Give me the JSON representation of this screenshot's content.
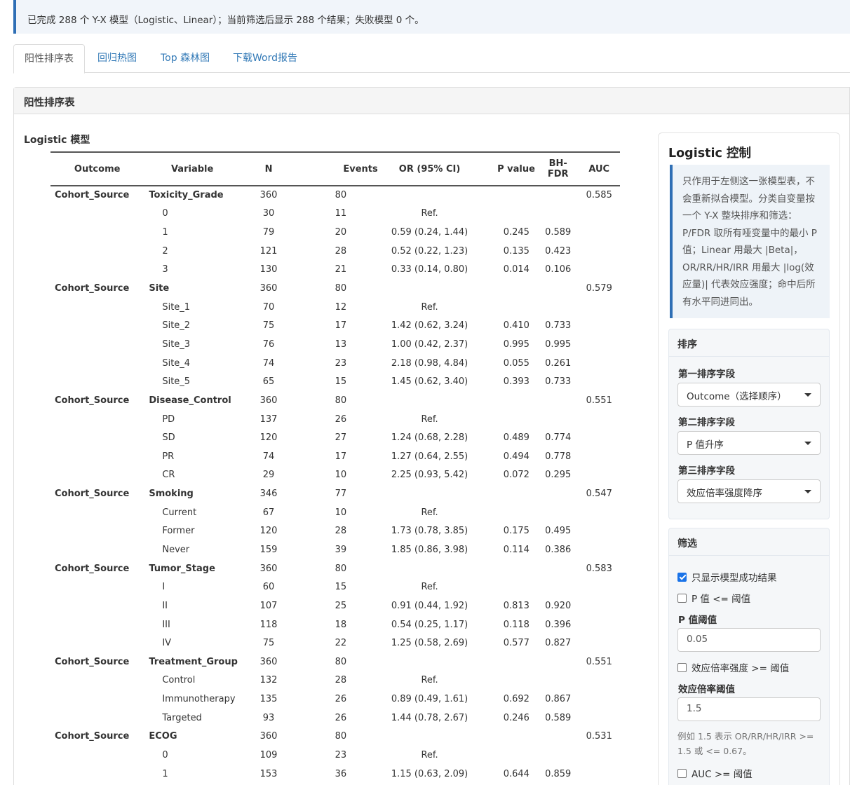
{
  "notice": "已完成 288 个 Y-X 模型（Logistic、Linear）；当前筛选后显示 288 个结果；失败模型 0 个。",
  "tabs": [
    "阳性排序表",
    "回归热图",
    "Top 森林图",
    "下载Word报告"
  ],
  "panel_title": "阳性排序表",
  "section_title": "Logistic 模型",
  "table": {
    "headers": {
      "outcome": "Outcome",
      "variable": "Variable",
      "n": "N",
      "events": "Events",
      "or": "OR (95% CI)",
      "p": "P value",
      "fdr": "BH-FDR",
      "auc": "AUC"
    },
    "rows": [
      {
        "t": "g",
        "outcome": "Cohort_Source",
        "variable": "Toxicity_Grade",
        "n": "360",
        "events": "80",
        "or": "",
        "p": "",
        "fdr": "",
        "auc": "0.585"
      },
      {
        "t": "l",
        "outcome": "",
        "variable": "0",
        "n": "30",
        "events": "11",
        "or": "Ref.",
        "p": "",
        "fdr": "",
        "auc": ""
      },
      {
        "t": "l",
        "outcome": "",
        "variable": "1",
        "n": "79",
        "events": "20",
        "or": "0.59 (0.24, 1.44)",
        "p": "0.245",
        "fdr": "0.589",
        "auc": ""
      },
      {
        "t": "l",
        "outcome": "",
        "variable": "2",
        "n": "121",
        "events": "28",
        "or": "0.52 (0.22, 1.23)",
        "p": "0.135",
        "fdr": "0.423",
        "auc": ""
      },
      {
        "t": "l",
        "outcome": "",
        "variable": "3",
        "n": "130",
        "events": "21",
        "or": "0.33 (0.14, 0.80)",
        "p": "0.014",
        "fdr": "0.106",
        "auc": ""
      },
      {
        "t": "g",
        "outcome": "Cohort_Source",
        "variable": "Site",
        "n": "360",
        "events": "80",
        "or": "",
        "p": "",
        "fdr": "",
        "auc": "0.579"
      },
      {
        "t": "l",
        "outcome": "",
        "variable": "Site_1",
        "n": "70",
        "events": "12",
        "or": "Ref.",
        "p": "",
        "fdr": "",
        "auc": ""
      },
      {
        "t": "l",
        "outcome": "",
        "variable": "Site_2",
        "n": "75",
        "events": "17",
        "or": "1.42 (0.62, 3.24)",
        "p": "0.410",
        "fdr": "0.733",
        "auc": ""
      },
      {
        "t": "l",
        "outcome": "",
        "variable": "Site_3",
        "n": "76",
        "events": "13",
        "or": "1.00 (0.42, 2.37)",
        "p": "0.995",
        "fdr": "0.995",
        "auc": ""
      },
      {
        "t": "l",
        "outcome": "",
        "variable": "Site_4",
        "n": "74",
        "events": "23",
        "or": "2.18 (0.98, 4.84)",
        "p": "0.055",
        "fdr": "0.261",
        "auc": ""
      },
      {
        "t": "l",
        "outcome": "",
        "variable": "Site_5",
        "n": "65",
        "events": "15",
        "or": "1.45 (0.62, 3.40)",
        "p": "0.393",
        "fdr": "0.733",
        "auc": ""
      },
      {
        "t": "g",
        "outcome": "Cohort_Source",
        "variable": "Disease_Control",
        "n": "360",
        "events": "80",
        "or": "",
        "p": "",
        "fdr": "",
        "auc": "0.551"
      },
      {
        "t": "l",
        "outcome": "",
        "variable": "PD",
        "n": "137",
        "events": "26",
        "or": "Ref.",
        "p": "",
        "fdr": "",
        "auc": ""
      },
      {
        "t": "l",
        "outcome": "",
        "variable": "SD",
        "n": "120",
        "events": "27",
        "or": "1.24 (0.68, 2.28)",
        "p": "0.489",
        "fdr": "0.774",
        "auc": ""
      },
      {
        "t": "l",
        "outcome": "",
        "variable": "PR",
        "n": "74",
        "events": "17",
        "or": "1.27 (0.64, 2.55)",
        "p": "0.494",
        "fdr": "0.778",
        "auc": ""
      },
      {
        "t": "l",
        "outcome": "",
        "variable": "CR",
        "n": "29",
        "events": "10",
        "or": "2.25 (0.93, 5.42)",
        "p": "0.072",
        "fdr": "0.295",
        "auc": ""
      },
      {
        "t": "g",
        "outcome": "Cohort_Source",
        "variable": "Smoking",
        "n": "346",
        "events": "77",
        "or": "",
        "p": "",
        "fdr": "",
        "auc": "0.547"
      },
      {
        "t": "l",
        "outcome": "",
        "variable": "Current",
        "n": "67",
        "events": "10",
        "or": "Ref.",
        "p": "",
        "fdr": "",
        "auc": ""
      },
      {
        "t": "l",
        "outcome": "",
        "variable": "Former",
        "n": "120",
        "events": "28",
        "or": "1.73 (0.78, 3.85)",
        "p": "0.175",
        "fdr": "0.495",
        "auc": ""
      },
      {
        "t": "l",
        "outcome": "",
        "variable": "Never",
        "n": "159",
        "events": "39",
        "or": "1.85 (0.86, 3.98)",
        "p": "0.114",
        "fdr": "0.386",
        "auc": ""
      },
      {
        "t": "g",
        "outcome": "Cohort_Source",
        "variable": "Tumor_Stage",
        "n": "360",
        "events": "80",
        "or": "",
        "p": "",
        "fdr": "",
        "auc": "0.583"
      },
      {
        "t": "l",
        "outcome": "",
        "variable": "I",
        "n": "60",
        "events": "15",
        "or": "Ref.",
        "p": "",
        "fdr": "",
        "auc": ""
      },
      {
        "t": "l",
        "outcome": "",
        "variable": "II",
        "n": "107",
        "events": "25",
        "or": "0.91 (0.44, 1.92)",
        "p": "0.813",
        "fdr": "0.920",
        "auc": ""
      },
      {
        "t": "l",
        "outcome": "",
        "variable": "III",
        "n": "118",
        "events": "18",
        "or": "0.54 (0.25, 1.17)",
        "p": "0.118",
        "fdr": "0.396",
        "auc": ""
      },
      {
        "t": "l",
        "outcome": "",
        "variable": "IV",
        "n": "75",
        "events": "22",
        "or": "1.25 (0.58, 2.69)",
        "p": "0.577",
        "fdr": "0.827",
        "auc": ""
      },
      {
        "t": "g",
        "outcome": "Cohort_Source",
        "variable": "Treatment_Group",
        "n": "360",
        "events": "80",
        "or": "",
        "p": "",
        "fdr": "",
        "auc": "0.551"
      },
      {
        "t": "l",
        "outcome": "",
        "variable": "Control",
        "n": "132",
        "events": "28",
        "or": "Ref.",
        "p": "",
        "fdr": "",
        "auc": ""
      },
      {
        "t": "l",
        "outcome": "",
        "variable": "Immunotherapy",
        "n": "135",
        "events": "26",
        "or": "0.89 (0.49, 1.61)",
        "p": "0.692",
        "fdr": "0.867",
        "auc": ""
      },
      {
        "t": "l",
        "outcome": "",
        "variable": "Targeted",
        "n": "93",
        "events": "26",
        "or": "1.44 (0.78, 2.67)",
        "p": "0.246",
        "fdr": "0.589",
        "auc": ""
      },
      {
        "t": "g",
        "outcome": "Cohort_Source",
        "variable": "ECOG",
        "n": "360",
        "events": "80",
        "or": "",
        "p": "",
        "fdr": "",
        "auc": "0.531"
      },
      {
        "t": "l",
        "outcome": "",
        "variable": "0",
        "n": "109",
        "events": "23",
        "or": "Ref.",
        "p": "",
        "fdr": "",
        "auc": ""
      },
      {
        "t": "l",
        "outcome": "",
        "variable": "1",
        "n": "153",
        "events": "36",
        "or": "1.15 (0.63, 2.09)",
        "p": "0.644",
        "fdr": "0.859",
        "auc": ""
      }
    ]
  },
  "side": {
    "title": "Logistic 控制",
    "note": "只作用于左侧这一张模型表，不会重新拟合模型。分类自变量按一个 Y-X 整块排序和筛选：P/FDR 取所有哑变量中的最小 P 值；Linear 用最大 |Beta|，OR/RR/HR/IRR 用最大 |log(效应量)| 代表效应强度；命中后所有水平同进同出。",
    "sort": {
      "title": "排序",
      "label1": "第一排序字段",
      "value1": "Outcome（选择顺序）",
      "label2": "第二排序字段",
      "value2": "P 值升序",
      "label3": "第三排序字段",
      "value3": "效应倍率强度降序"
    },
    "filter": {
      "title": "筛选",
      "only_success": "只显示模型成功结果",
      "only_success_checked": true,
      "p_filter": "P 值 <= 阈值",
      "p_filter_checked": false,
      "p_label": "P 值阈值",
      "p_value": "0.05",
      "effect_filter": "效应倍率强度 >= 阈值",
      "effect_filter_checked": false,
      "effect_label": "效应倍率阈值",
      "effect_value": "1.5",
      "effect_help": "例如 1.5 表示 OR/RR/HR/IRR >= 1.5 或 <= 0.67。",
      "auc_filter": "AUC >= 阈值",
      "auc_filter_checked": false
    }
  }
}
